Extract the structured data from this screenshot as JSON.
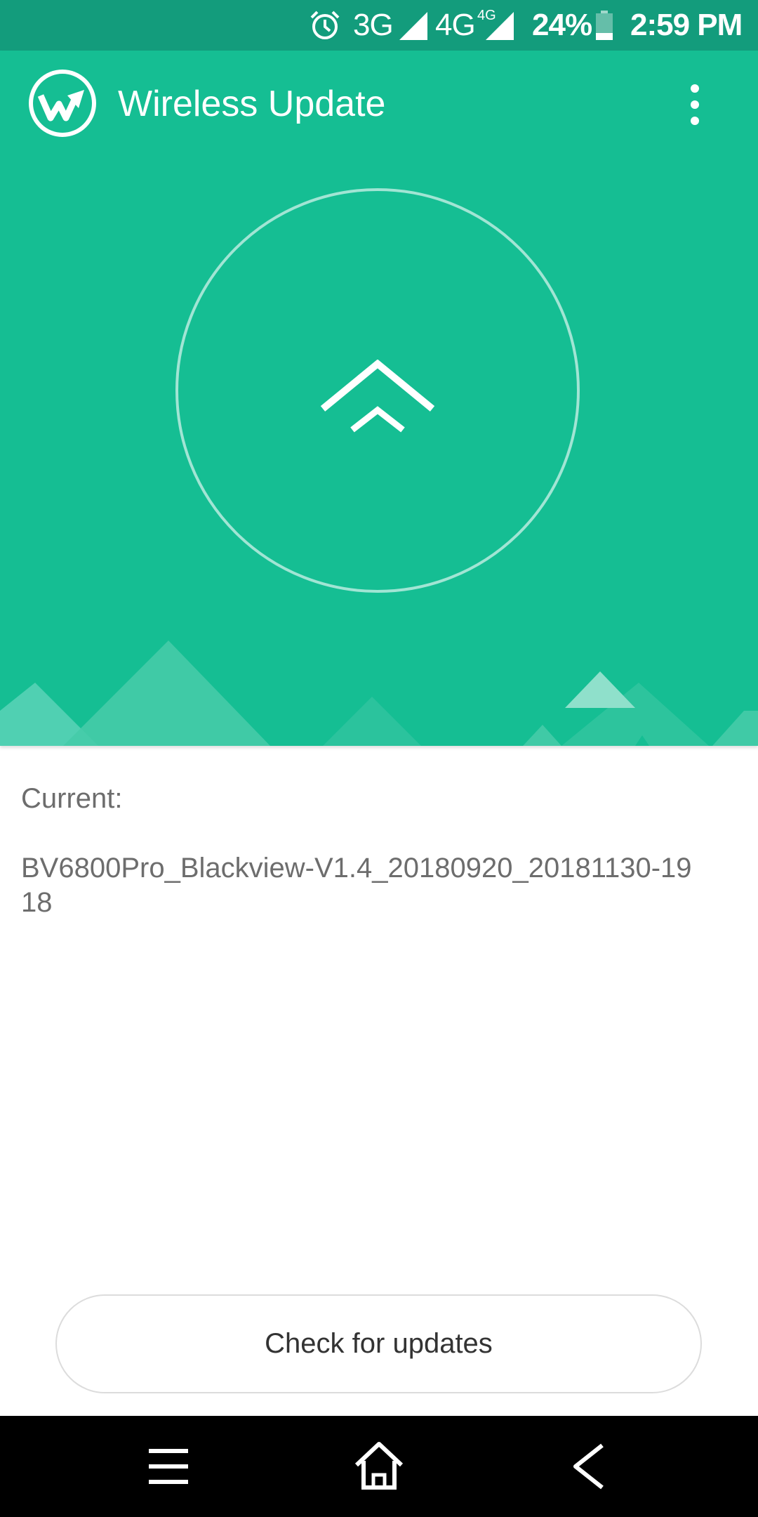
{
  "status_bar": {
    "network_1": "3G",
    "network_2": "4G",
    "network_2_badge": "4G",
    "battery": "24%",
    "time": "2:59 PM",
    "icons": [
      "alarm-icon",
      "signal-icon",
      "signal-icon",
      "battery-icon"
    ]
  },
  "app_bar": {
    "title": "Wireless Update",
    "logo_icon": "wireless-update-logo-icon",
    "menu_icon": "more-vert-icon"
  },
  "hero": {
    "button_icon": "double-chevron-up-icon",
    "background_color": "#15be93",
    "status_bar_color": "#139c7c"
  },
  "info": {
    "current_label": "Current:",
    "version": "BV6800Pro_Blackview-V1.4_20180920_20181130-1918"
  },
  "actions": {
    "check_updates": "Check for updates"
  },
  "nav_bar": {
    "icons": [
      "menu-icon",
      "home-icon",
      "back-icon"
    ]
  }
}
